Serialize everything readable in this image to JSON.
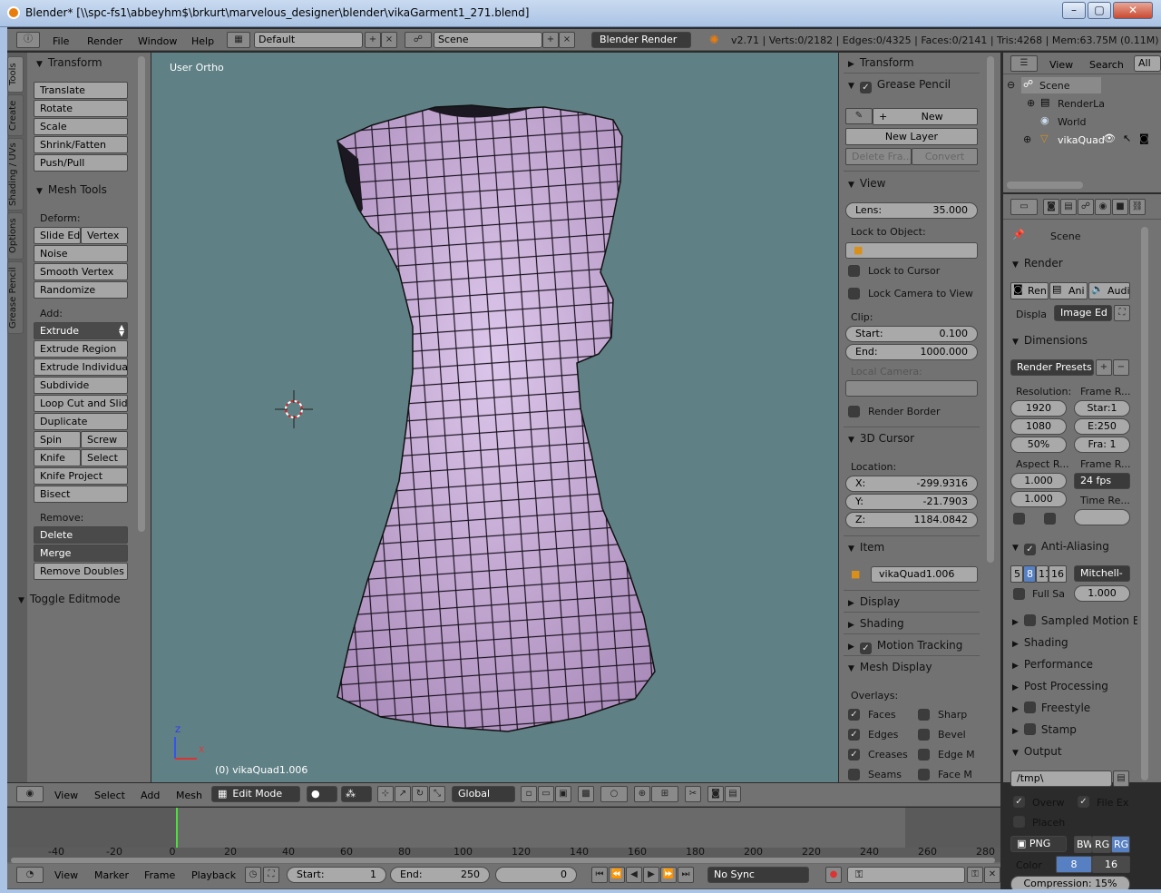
{
  "window": {
    "title": "Blender* [\\\\spc-fs1\\abbeyhm$\\brkurt\\marvelous_designer\\blender\\vikaGarment1_271.blend]"
  },
  "infobar": {
    "menus": [
      "File",
      "Render",
      "Window",
      "Help"
    ],
    "layout": "Default",
    "scene": "Scene",
    "engine": "Blender Render",
    "stats": "v2.71 | Verts:0/2182 | Edges:0/4325 | Faces:0/2141 | Tris:4268 | Mem:63.75M (0.11M) | vik"
  },
  "toolshelf": {
    "tabs": [
      "Tools",
      "Create",
      "Shading / UVs",
      "Options",
      "Grease Pencil"
    ],
    "transform_header": "Transform",
    "transform": [
      "Translate",
      "Rotate",
      "Scale",
      "Shrink/Fatten",
      "Push/Pull"
    ],
    "meshtools_header": "Mesh Tools",
    "deform_label": "Deform:",
    "slide_edge": "Slide Ed",
    "vertex": "Vertex",
    "noise": "Noise",
    "smooth_vertex": "Smooth Vertex",
    "randomize": "Randomize",
    "add_label": "Add:",
    "extrude": "Extrude",
    "extrude_region": "Extrude Region",
    "extrude_individual": "Extrude Individual",
    "subdivide": "Subdivide",
    "loop_cut": "Loop Cut and Slide",
    "duplicate": "Duplicate",
    "spin": "Spin",
    "screw": "Screw",
    "knife": "Knife",
    "select": "Select",
    "knife_project": "Knife Project",
    "bisect": "Bisect",
    "remove_label": "Remove:",
    "delete": "Delete",
    "merge": "Merge",
    "remove_doubles": "Remove Doubles",
    "toggle_editmode": "Toggle Editmode"
  },
  "viewport": {
    "view_label": "User Ortho",
    "object_label": "(0) vikaQuad1.006",
    "bg": "#5f8085",
    "mesh_color": "#c9aed9",
    "axis_z": "Z",
    "axis_x": "X"
  },
  "npanel": {
    "transform": "Transform",
    "grease_pencil": "Grease Pencil",
    "new": "New",
    "new_layer": "New Layer",
    "delete_frame": "Delete Fra...",
    "convert": "Convert",
    "view": "View",
    "lens_label": "Lens:",
    "lens": "35.000",
    "lock_object": "Lock to Object:",
    "lock_cursor": "Lock to Cursor",
    "lock_camera": "Lock Camera to View",
    "clip": "Clip:",
    "start_label": "Start:",
    "start": "0.100",
    "end_label": "End:",
    "end": "1000.000",
    "local_camera": "Local Camera:",
    "render_border": "Render Border",
    "cursor": "3D Cursor",
    "location": "Location:",
    "x_label": "X:",
    "x": "-299.9316",
    "y_label": "Y:",
    "y": "-21.7903",
    "z_label": "Z:",
    "z": "1184.0842",
    "item": "Item",
    "item_name": "vikaQuad1.006",
    "display": "Display",
    "shading": "Shading",
    "motion_tracking": "Motion Tracking",
    "mesh_display": "Mesh Display",
    "overlays": "Overlays:",
    "faces": "Faces",
    "sharp": "Sharp",
    "edges": "Edges",
    "bevel": "Bevel",
    "creases": "Creases",
    "edge_m": "Edge M",
    "seams": "Seams",
    "face_m": "Face M"
  },
  "outliner": {
    "menus": [
      "View",
      "Search"
    ],
    "all": "All",
    "items": [
      "Scene",
      "RenderLa",
      "World",
      "vikaQuad"
    ]
  },
  "properties": {
    "scene": "Scene",
    "render": "Render",
    "render_btns": [
      "Ren",
      "Ani",
      "Audi"
    ],
    "display_label": "Displa",
    "display_val": "Image Ed",
    "dimensions": "Dimensions",
    "presets": "Render Presets",
    "resolution": "Resolution:",
    "frame_range": "Frame R...",
    "res_x": "1920",
    "res_y": "1080",
    "res_pct": "50%",
    "start": "Star:1",
    "end": "E:250",
    "frame": "Fra: 1",
    "aspect": "Aspect R...",
    "frame_rate": "Frame R...",
    "asp_x": "1.000",
    "asp_y": "1.000",
    "fps": "24 fps",
    "time_remap": "Time Re...",
    "anti_aliasing": "Anti-Aliasing",
    "aa_samples": [
      "5",
      "8",
      "11",
      "16"
    ],
    "aa_filter": "Mitchell-",
    "full_sample": "Full Sa",
    "aa_size": "1.000",
    "motion_blur": "Sampled Motion Bl",
    "shading": "Shading",
    "performance": "Performance",
    "post_processing": "Post Processing",
    "freestyle": "Freestyle",
    "stamp": "Stamp",
    "output": "Output",
    "path": "/tmp\\",
    "overwrite": "Overw",
    "file_ext": "File Ex",
    "placeholders": "Placeh",
    "format": "PNG",
    "bw": "BW",
    "rgb": "RG",
    "rgba": "RG",
    "color_label": "Color",
    "depth_8": "8",
    "depth_16": "16",
    "compression": "Compression: 15%"
  },
  "view3d_header": {
    "menus": [
      "View",
      "Select",
      "Add",
      "Mesh"
    ],
    "mode": "Edit Mode",
    "orientation": "Global"
  },
  "timeline": {
    "ticks": [
      "-40",
      "-20",
      "0",
      "20",
      "40",
      "60",
      "80",
      "100",
      "120",
      "140",
      "160",
      "180",
      "200",
      "220",
      "240",
      "260",
      "280"
    ],
    "menus": [
      "View",
      "Marker",
      "Frame",
      "Playback"
    ],
    "start_label": "Start:",
    "start": "1",
    "end_label": "End:",
    "end": "250",
    "current": "0",
    "sync": "No Sync"
  }
}
